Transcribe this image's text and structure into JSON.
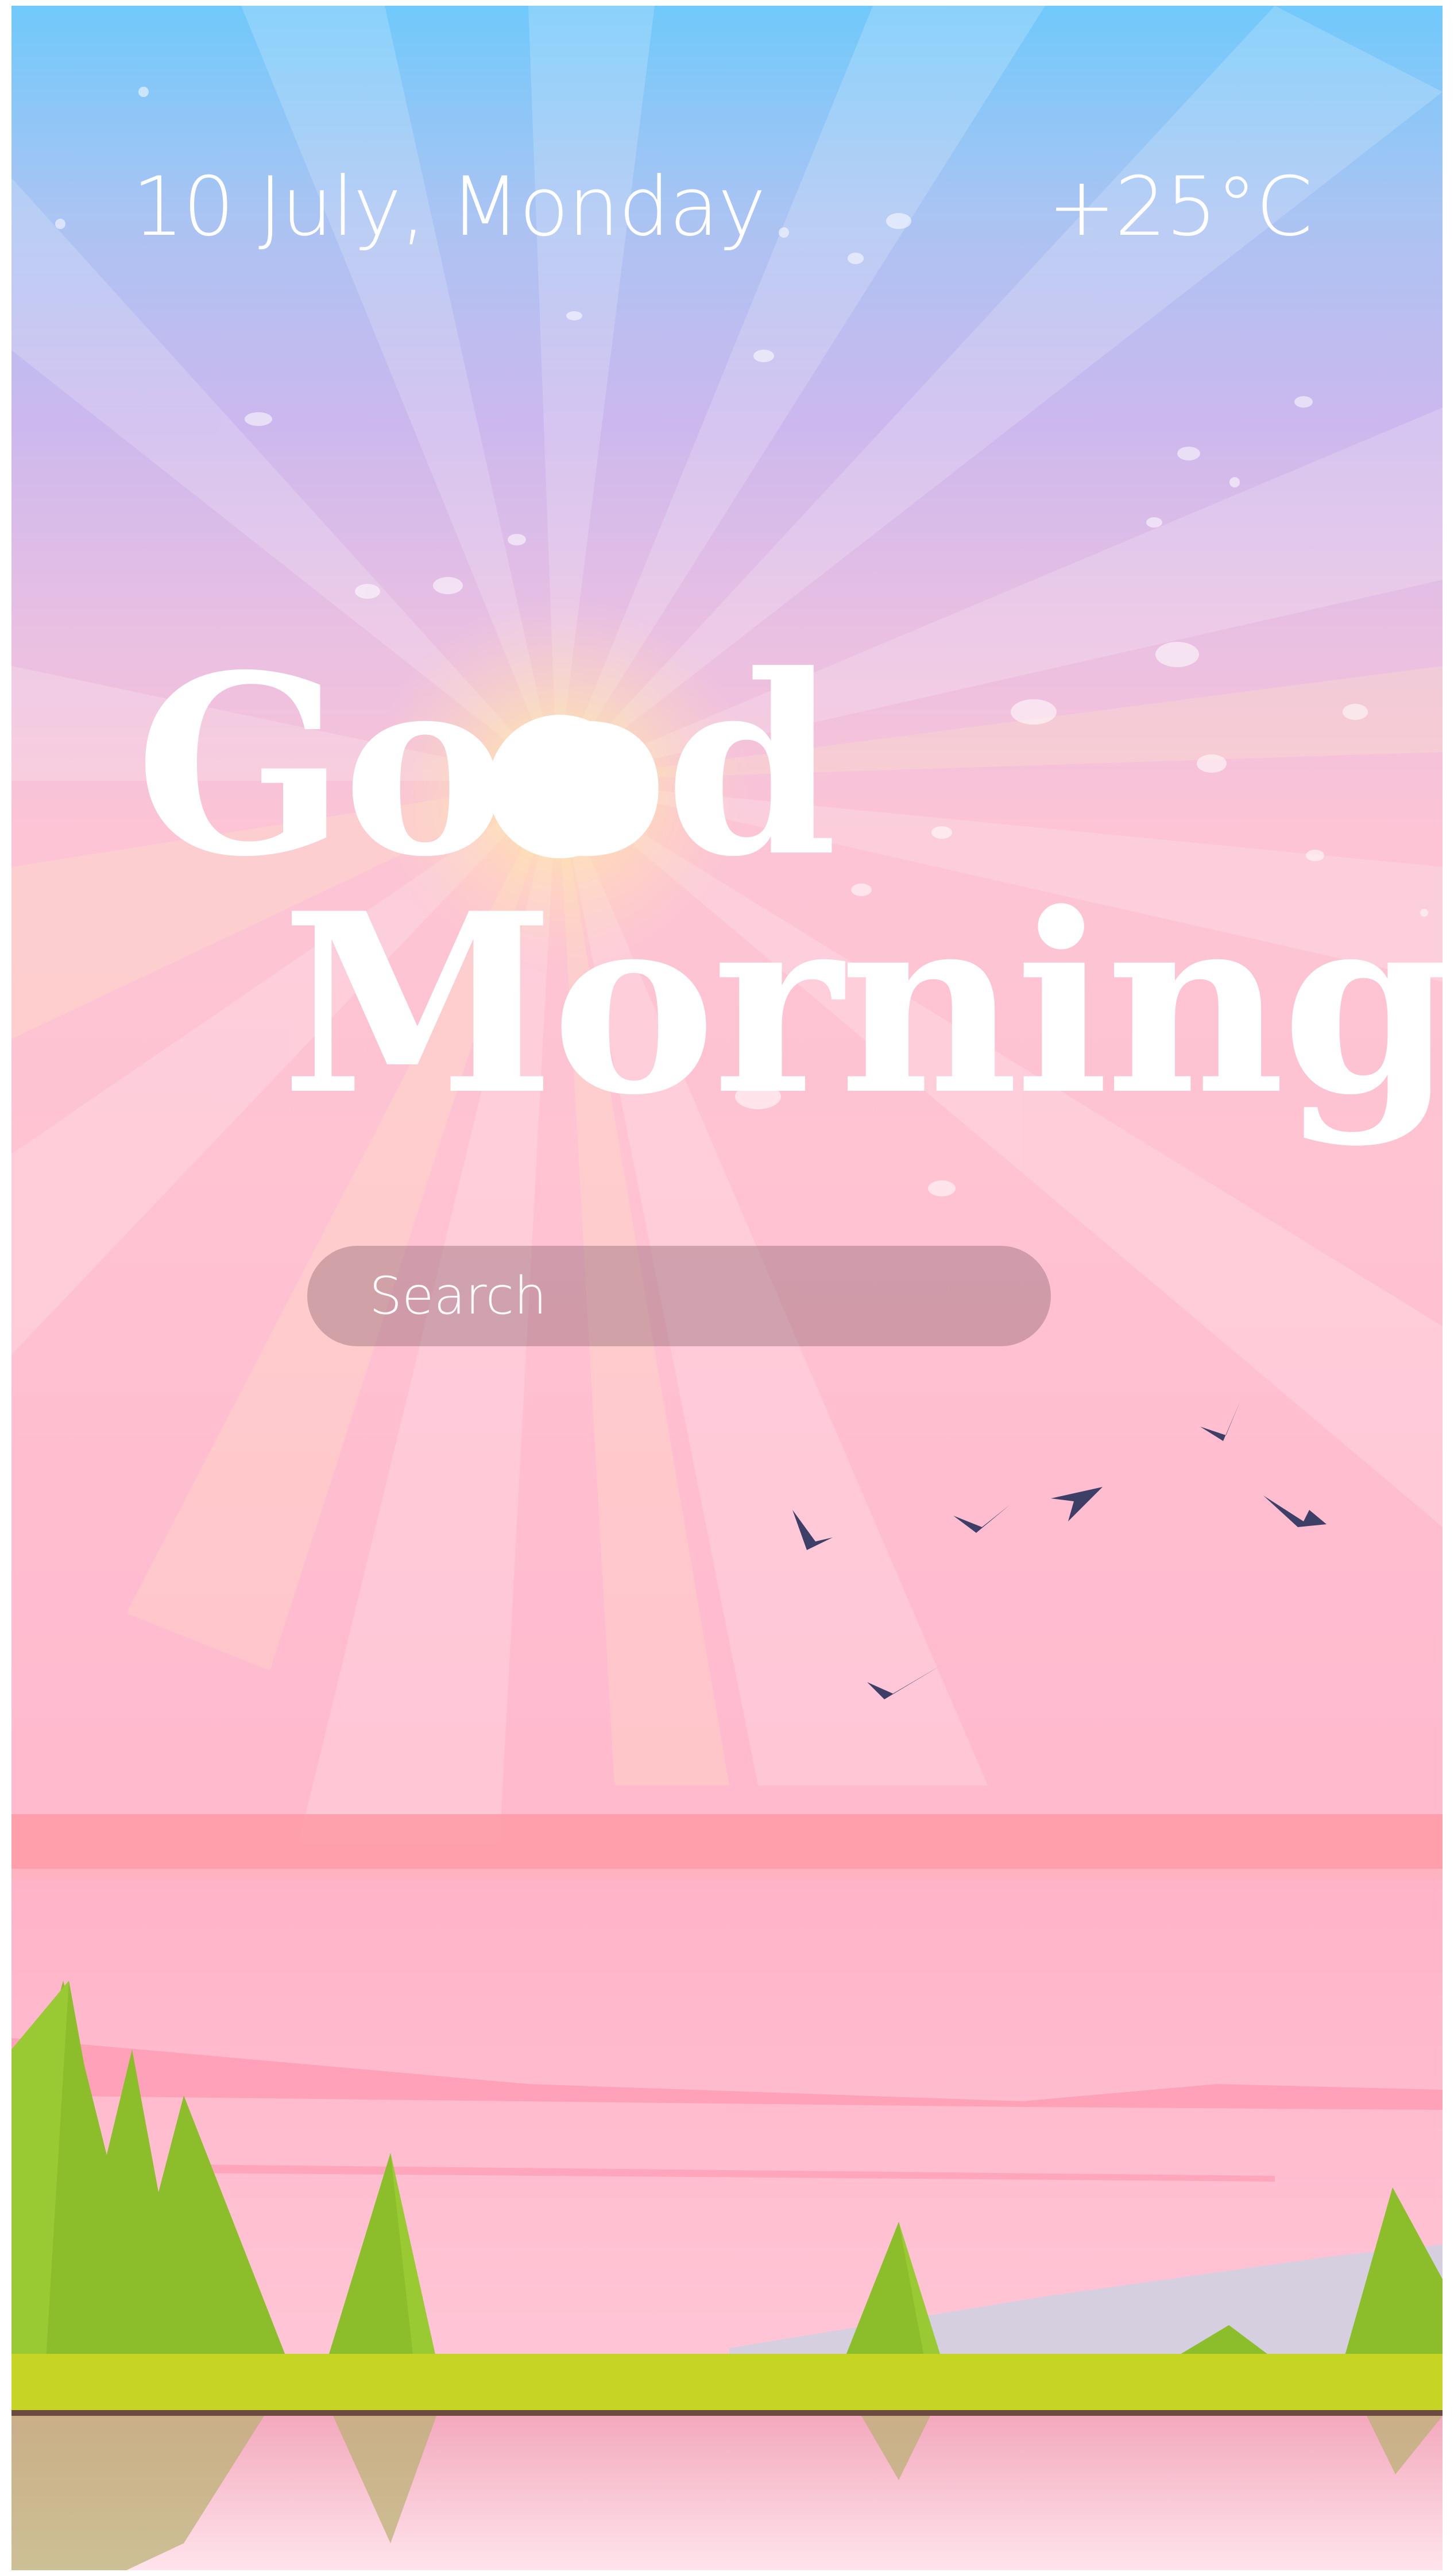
{
  "header": {
    "date": "10 July, Monday",
    "temperature": "+25°C"
  },
  "greeting": {
    "line1": "Good",
    "line2": "Morning"
  },
  "search": {
    "placeholder": "Search",
    "value": ""
  },
  "colors": {
    "sky_top": "#70c9fb",
    "sky_mid": "#cbb8ee",
    "sky_low": "#ffc3d2",
    "sun": "#ffffff",
    "horizon_band": "#ff9aa6",
    "grass": "#c6d424",
    "tree": "#8bbe2a",
    "bird": "#3e3f66",
    "search_bg": "#8a626e"
  }
}
